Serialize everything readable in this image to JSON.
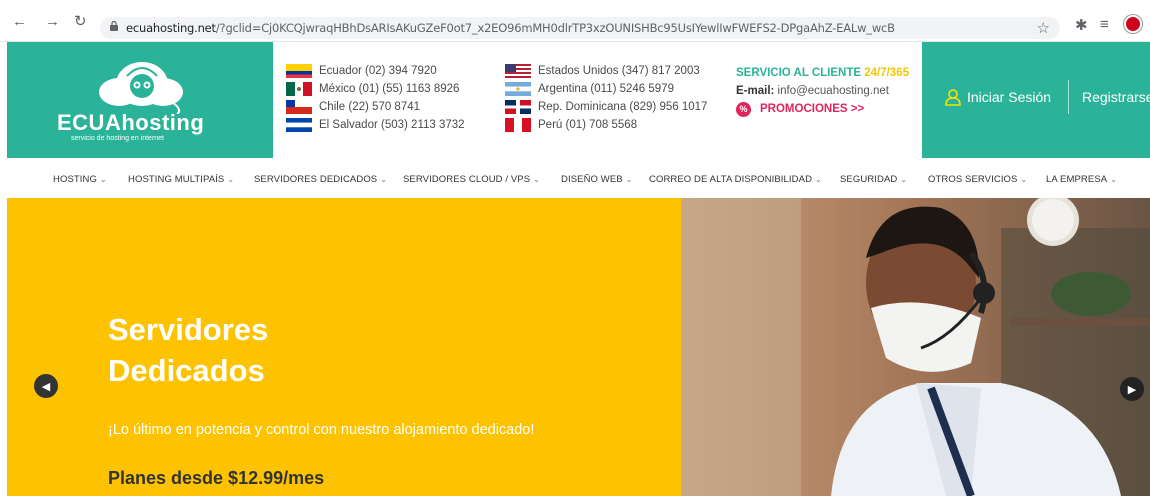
{
  "browser": {
    "url_domain": "ecuahosting.net",
    "url_rest": "/?gclid=Cj0KCQjwraqHBhDsARIsAKuGZeF0ot7_x2EO96mMH0dlrTP3xzOUNISHBc95UsIYewlIwFWEFS2-DPgaAhZ-EALw_wcB"
  },
  "logo": {
    "name": "ECUAhosting",
    "tagline": "servicio de hosting en internet"
  },
  "contacts_left": [
    {
      "flag": "ecuador-flag",
      "text": "Ecuador (02) 394 7920"
    },
    {
      "flag": "mexico-flag",
      "text": "México (01) (55) 1163 8926"
    },
    {
      "flag": "chile-flag",
      "text": "Chile (22) 570 8741"
    },
    {
      "flag": "el-salvador-flag",
      "text": "El Salvador (503) 2113 3732"
    }
  ],
  "contacts_right": [
    {
      "flag": "usa-flag",
      "text": "Estados Unidos (347) 817 2003"
    },
    {
      "flag": "argentina-flag",
      "text": "Argentina (011) 5246 5979"
    },
    {
      "flag": "dominican-flag",
      "text": "Rep. Dominicana (829) 956 1017"
    },
    {
      "flag": "peru-flag",
      "text": "Perú (01) 708 5568"
    }
  ],
  "service": {
    "title": "SERVICIO AL CLIENTE",
    "hours": "24/7/365",
    "email_label": "E-mail:",
    "email": "info@ecuahosting.net",
    "promo": "PROMOCIONES >>"
  },
  "auth": {
    "login": "Iniciar Sesión",
    "register": "Registrarse"
  },
  "nav": [
    "HOSTING",
    "HOSTING MULTIPAÍS",
    "SERVIDORES DEDICADOS",
    "SERVIDORES CLOUD / VPS",
    "DISEÑO WEB",
    "CORREO DE ALTA DISPONIBILIDAD",
    "SEGURIDAD",
    "OTROS SERVICIOS",
    "LA EMPRESA"
  ],
  "hero": {
    "title_line1": "Servidores",
    "title_line2": "Dedicados",
    "subtitle": "¡Lo último en potencia y control con nuestro alojamiento dedicado!",
    "price": "Planes desde $12.99/mes"
  },
  "colors": {
    "brand": "#2bb39a",
    "hero": "#fdc300",
    "accent": "#f5c400",
    "promo": "#e0245e"
  }
}
